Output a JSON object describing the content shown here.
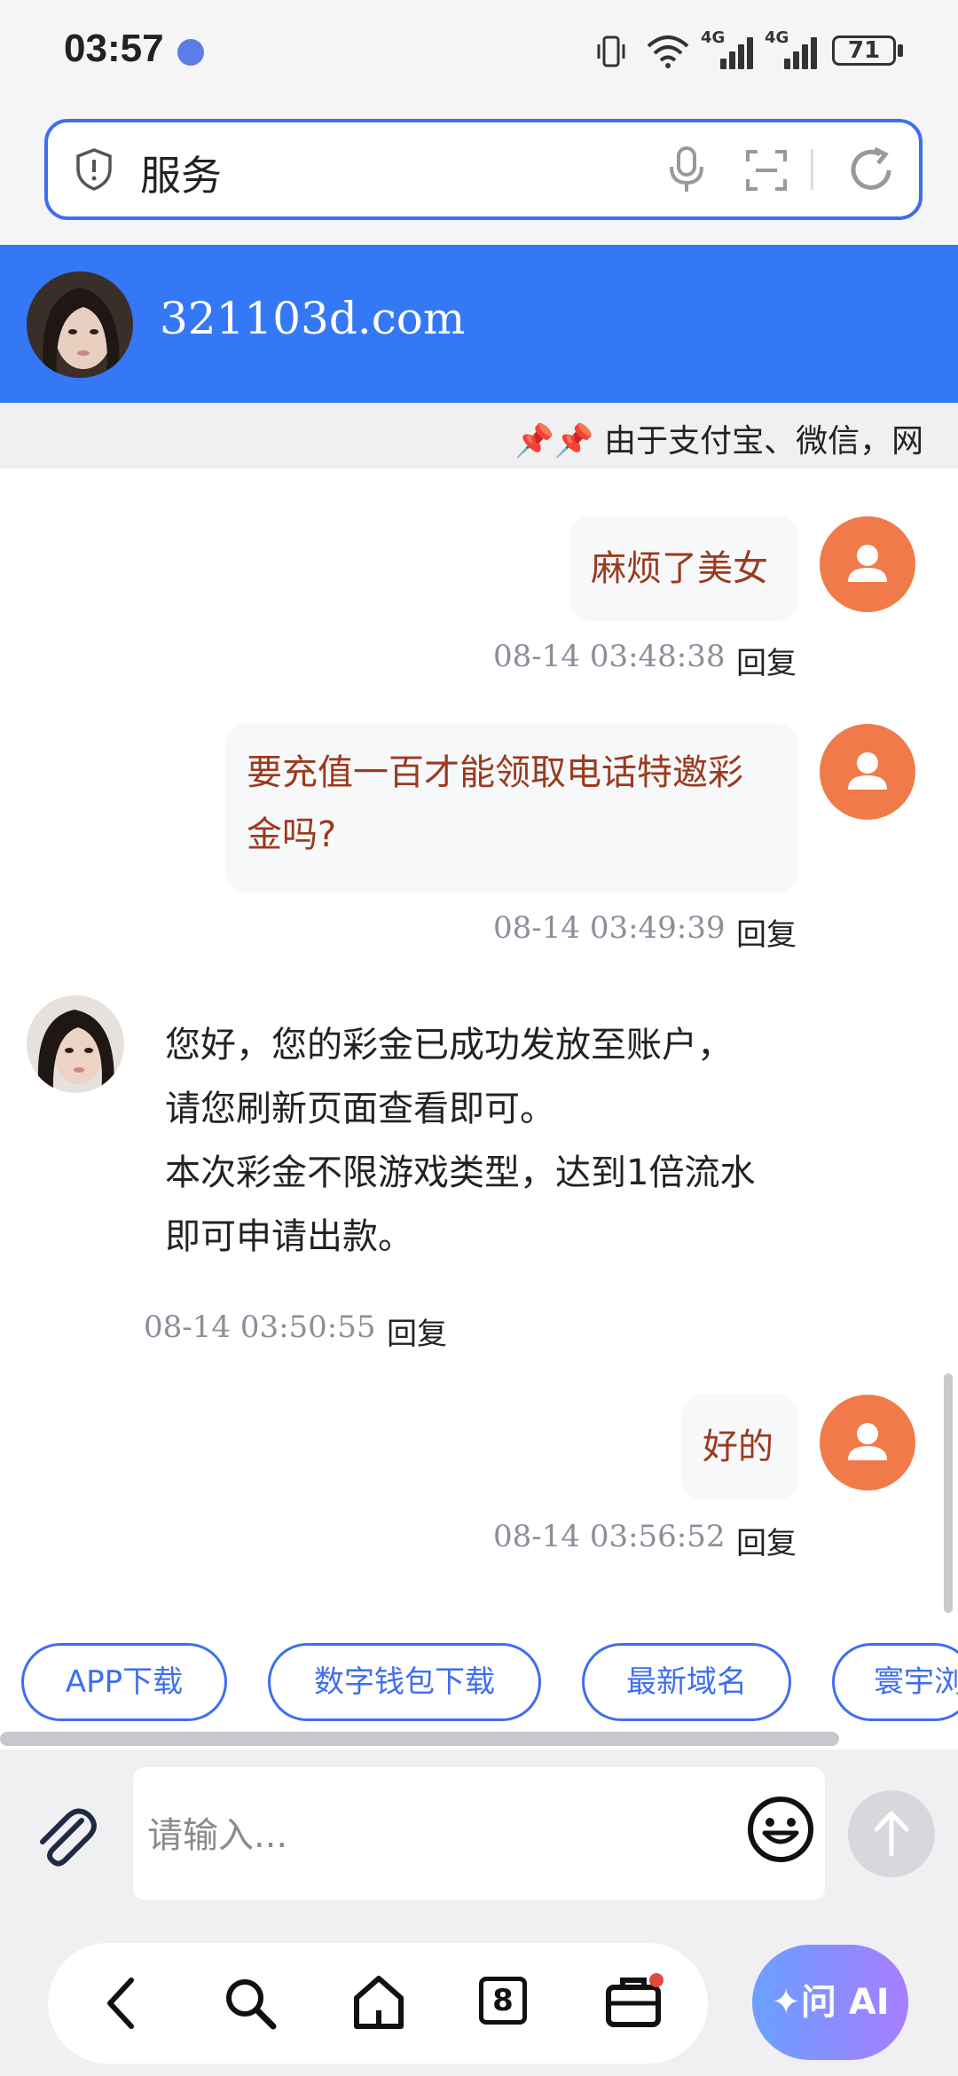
{
  "status_bar": {
    "time": "03:57",
    "network_1": "4G",
    "network_2": "4G",
    "battery": "71"
  },
  "search": {
    "query": "服务"
  },
  "chat": {
    "title": "321103d.com",
    "marquee": "📌📌 由于支付宝、微信，网",
    "messages": [
      {
        "from": "user",
        "text": "麻烦了美女",
        "time": "08-14 03:48:38",
        "reply": "回复"
      },
      {
        "from": "user",
        "lines": [
          "要充值一百才能领取电话特邀彩",
          "金吗?"
        ],
        "time": "08-14 03:49:39",
        "reply": "回复"
      },
      {
        "from": "agent",
        "lines": [
          "您好，您的彩金已成功发放至账户，",
          "请您刷新页面查看即可。",
          "本次彩金不限游戏类型，达到1倍流水",
          "即可申请出款。"
        ],
        "time": "08-14 03:50:55",
        "reply": "回复"
      },
      {
        "from": "user",
        "text": "好的",
        "time": "08-14 03:56:52",
        "reply": "回复"
      }
    ]
  },
  "quick_tags": [
    "APP下载",
    "数字钱包下载",
    "最新域名",
    "寰宇浏"
  ],
  "input": {
    "placeholder": "请输入..."
  },
  "browser_nav": {
    "tabs_count": "8",
    "ai_label": "问 AI"
  },
  "colors": {
    "accent": "#3478f6",
    "user_avatar": "#f07a4a",
    "bubble_text": "#9a3a1e"
  },
  "icons": [
    "vibrate-icon",
    "wifi-icon",
    "signal-icon",
    "shield-icon",
    "mic-icon",
    "scan-icon",
    "refresh-icon",
    "paperclip-icon",
    "emoji-icon",
    "send-arrow-icon",
    "back-icon",
    "search-icon",
    "home-icon",
    "tabs-icon",
    "briefcase-icon",
    "sparkle-icon"
  ]
}
